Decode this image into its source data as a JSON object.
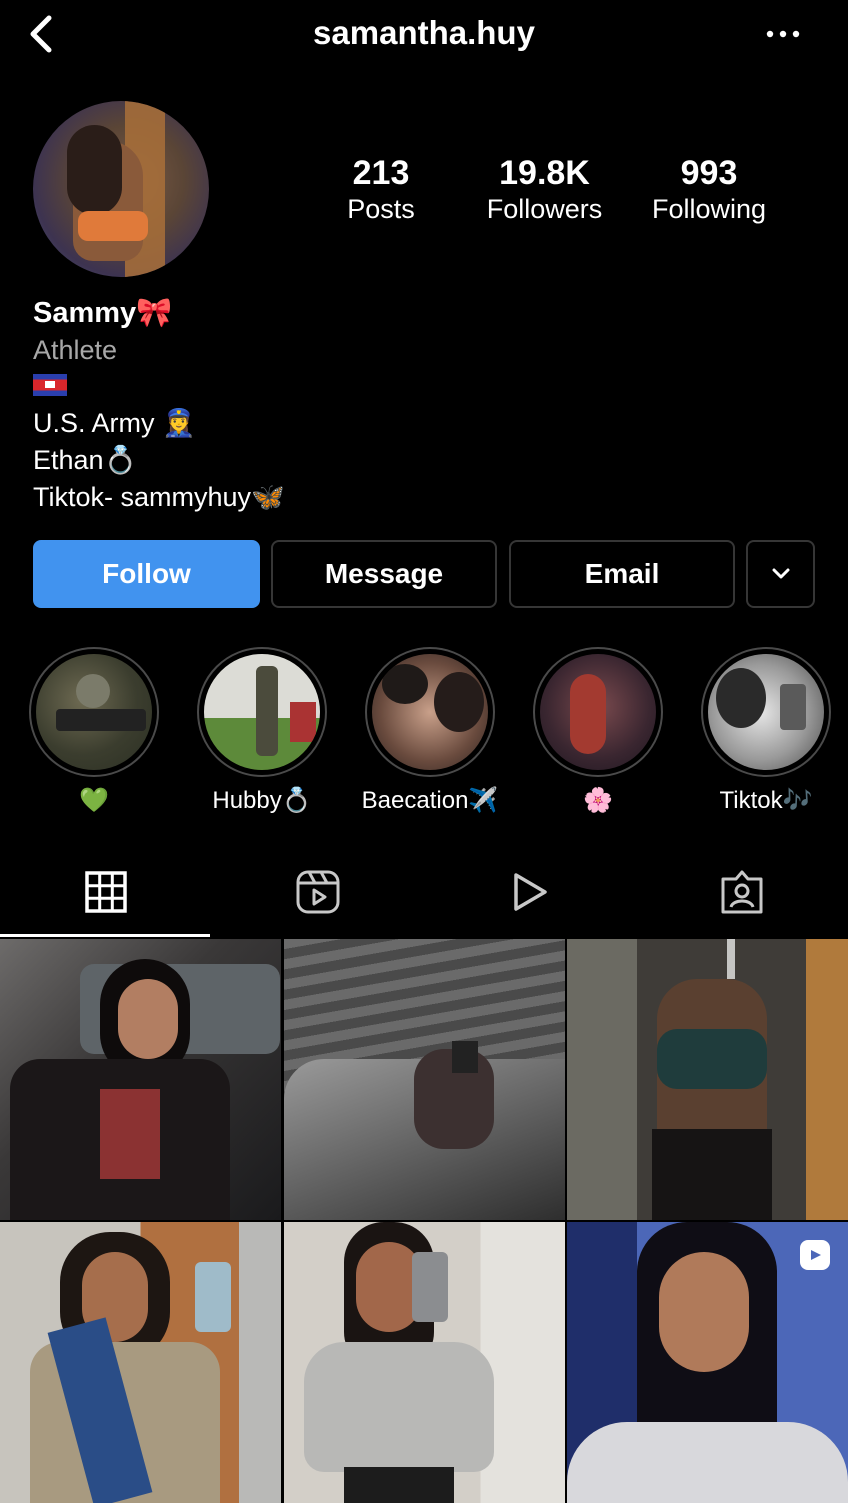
{
  "header": {
    "username": "samantha.huy",
    "back_icon": "chevron-left-icon",
    "more_icon": "ellipsis-icon"
  },
  "stats": [
    {
      "value": "213",
      "label": "Posts"
    },
    {
      "value": "19.8K",
      "label": "Followers"
    },
    {
      "value": "993",
      "label": "Following"
    }
  ],
  "bio": {
    "name": "Sammy🎀",
    "category": "Athlete",
    "flag_icon": "cambodia-flag-icon",
    "lines": [
      "U.S. Army 👮‍♀️",
      "Ethan💍",
      "Tiktok- sammyhuy🦋"
    ]
  },
  "actions": {
    "follow": "Follow",
    "message": "Message",
    "email": "Email"
  },
  "highlights": [
    {
      "label": "💚"
    },
    {
      "label": "Hubby💍"
    },
    {
      "label": "Baecation✈️"
    },
    {
      "label": "🌸"
    },
    {
      "label": "Tiktok🎶"
    }
  ],
  "tabs": [
    "grid-icon",
    "reels-icon",
    "video-icon",
    "tagged-icon"
  ],
  "colors": {
    "accent": "#4193ef",
    "background": "#000000",
    "border": "#363636",
    "muted": "#a8a8a8"
  }
}
